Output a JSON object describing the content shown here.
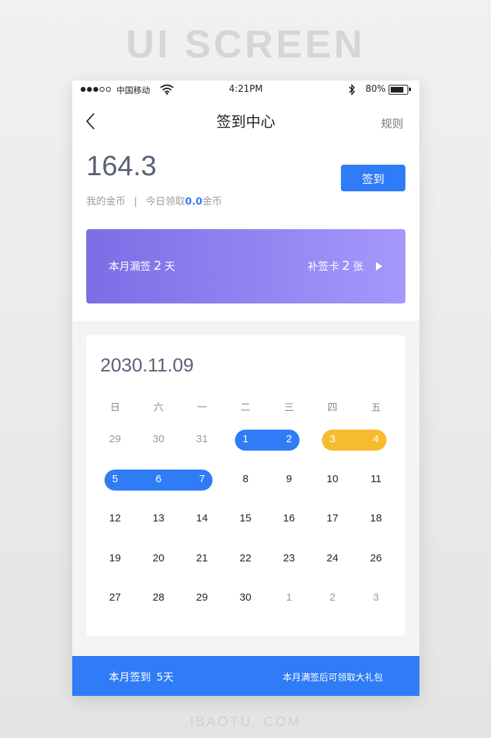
{
  "banner": {
    "title": "UI SCREEN",
    "footer": "IBAOTU. COM"
  },
  "status_bar": {
    "carrier": "中国移动",
    "time": "4:21PM",
    "battery": "80%"
  },
  "nav": {
    "title": "签到中心",
    "rules": "规则"
  },
  "coins": {
    "value": "164.3",
    "label": "我的金币",
    "separator": "|",
    "today_prefix": "今日领取",
    "today_value": "0.0",
    "today_suffix": "金币",
    "signin_label": "签到"
  },
  "missed": {
    "prefix": "本月漏签",
    "count": "2",
    "suffix": "天",
    "card_prefix": "补签卡",
    "card_count": "2",
    "card_suffix": "张"
  },
  "calendar": {
    "date": "2030.11.09",
    "weekdays": [
      "日",
      "六",
      "一",
      "二",
      "三",
      "四",
      "五"
    ],
    "rows": [
      [
        {
          "d": "29",
          "state": "muted"
        },
        {
          "d": "30",
          "state": "muted"
        },
        {
          "d": "31",
          "state": "muted"
        },
        {
          "d": "1",
          "state": "signed"
        },
        {
          "d": "2",
          "state": "signed"
        },
        {
          "d": "3",
          "state": "makeup"
        },
        {
          "d": "4",
          "state": "makeup"
        }
      ],
      [
        {
          "d": "5",
          "state": "signed"
        },
        {
          "d": "6",
          "state": "signed"
        },
        {
          "d": "7",
          "state": "signed"
        },
        {
          "d": "8",
          "state": "normal"
        },
        {
          "d": "9",
          "state": "normal"
        },
        {
          "d": "10",
          "state": "normal"
        },
        {
          "d": "11",
          "state": "normal"
        }
      ],
      [
        {
          "d": "12",
          "state": "normal"
        },
        {
          "d": "13",
          "state": "normal"
        },
        {
          "d": "14",
          "state": "normal"
        },
        {
          "d": "15",
          "state": "normal"
        },
        {
          "d": "16",
          "state": "normal"
        },
        {
          "d": "17",
          "state": "normal"
        },
        {
          "d": "18",
          "state": "normal"
        }
      ],
      [
        {
          "d": "19",
          "state": "normal"
        },
        {
          "d": "20",
          "state": "normal"
        },
        {
          "d": "21",
          "state": "normal"
        },
        {
          "d": "22",
          "state": "normal"
        },
        {
          "d": "23",
          "state": "normal"
        },
        {
          "d": "24",
          "state": "normal"
        },
        {
          "d": "26",
          "state": "normal"
        }
      ],
      [
        {
          "d": "27",
          "state": "normal"
        },
        {
          "d": "28",
          "state": "normal"
        },
        {
          "d": "29",
          "state": "normal"
        },
        {
          "d": "30",
          "state": "normal"
        },
        {
          "d": "1",
          "state": "muted"
        },
        {
          "d": "2",
          "state": "muted"
        },
        {
          "d": "3",
          "state": "muted"
        }
      ]
    ],
    "colors": {
      "signed": "#2f7cf6",
      "makeup": "#f7bb2e"
    }
  },
  "footer_bar": {
    "signed_prefix": "本月签到",
    "signed_count": "5天",
    "gift_note": "本月满签后可领取大礼包"
  }
}
